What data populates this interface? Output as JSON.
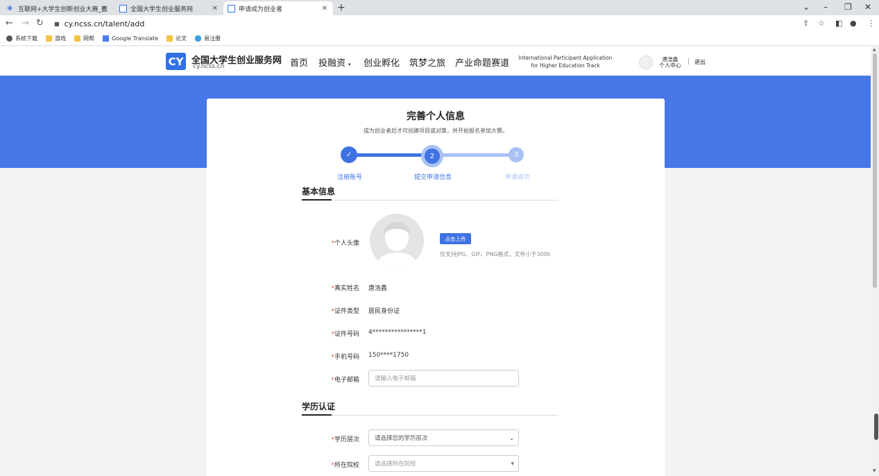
{
  "browser": {
    "tabs": [
      {
        "title": "互联网+大学生创新创业大赛_面"
      },
      {
        "title": "全国大学生创业服务网"
      },
      {
        "title": "申请成为创业者"
      }
    ],
    "url": "cy.ncss.cn/talent/add",
    "bookmarks": [
      "系统下载",
      "游戏",
      "网帮",
      "Google Translate",
      "论文",
      "易注册"
    ]
  },
  "site": {
    "logo_mark": "CY",
    "logo_title": "全国大学生创业服务网",
    "logo_sub": "cy.ncss.cn",
    "nav": [
      "首页",
      "投融资",
      "创业孵化",
      "筑梦之旅",
      "产业命题赛道"
    ],
    "intl_line1": "International Participant Application",
    "intl_line2": "for Higher Education Track",
    "user_name": "唐浩鑫",
    "user_center": "个人中心",
    "separator": "|",
    "logout": "退出"
  },
  "card": {
    "title": "完善个人信息",
    "subtitle": "成为创业者后才可创建项目或对策，并开始报名参加大赛。",
    "steps": [
      {
        "num": "✓",
        "label": "注册账号"
      },
      {
        "num": "2",
        "label": "提交申请信息"
      },
      {
        "num": "3",
        "label": "申请成功"
      }
    ]
  },
  "basic": {
    "title": "基本信息",
    "avatar_label": "个人头像",
    "upload_btn": "点击上传",
    "upload_tip": "仅支持JPG、GIF、PNG格式，文件小于300k",
    "name_label": "真实姓名",
    "name_value": "唐浩鑫",
    "idtype_label": "证件类型",
    "idtype_value": "居民身份证",
    "idnum_label": "证件号码",
    "idnum_value": "4****************1",
    "phone_label": "手机号码",
    "phone_value": "150****1750",
    "email_label": "电子邮箱",
    "email_placeholder": "请输入电子邮箱"
  },
  "edu": {
    "title": "学历认证",
    "level_label": "学历层次",
    "level_placeholder": "请选择您的学历层次",
    "school_label": "所在院校",
    "school_placeholder": "请选择所在院校"
  },
  "colors": {
    "accent": "#4776e6",
    "button": "#3f73e3",
    "required": "#e74c3c"
  }
}
